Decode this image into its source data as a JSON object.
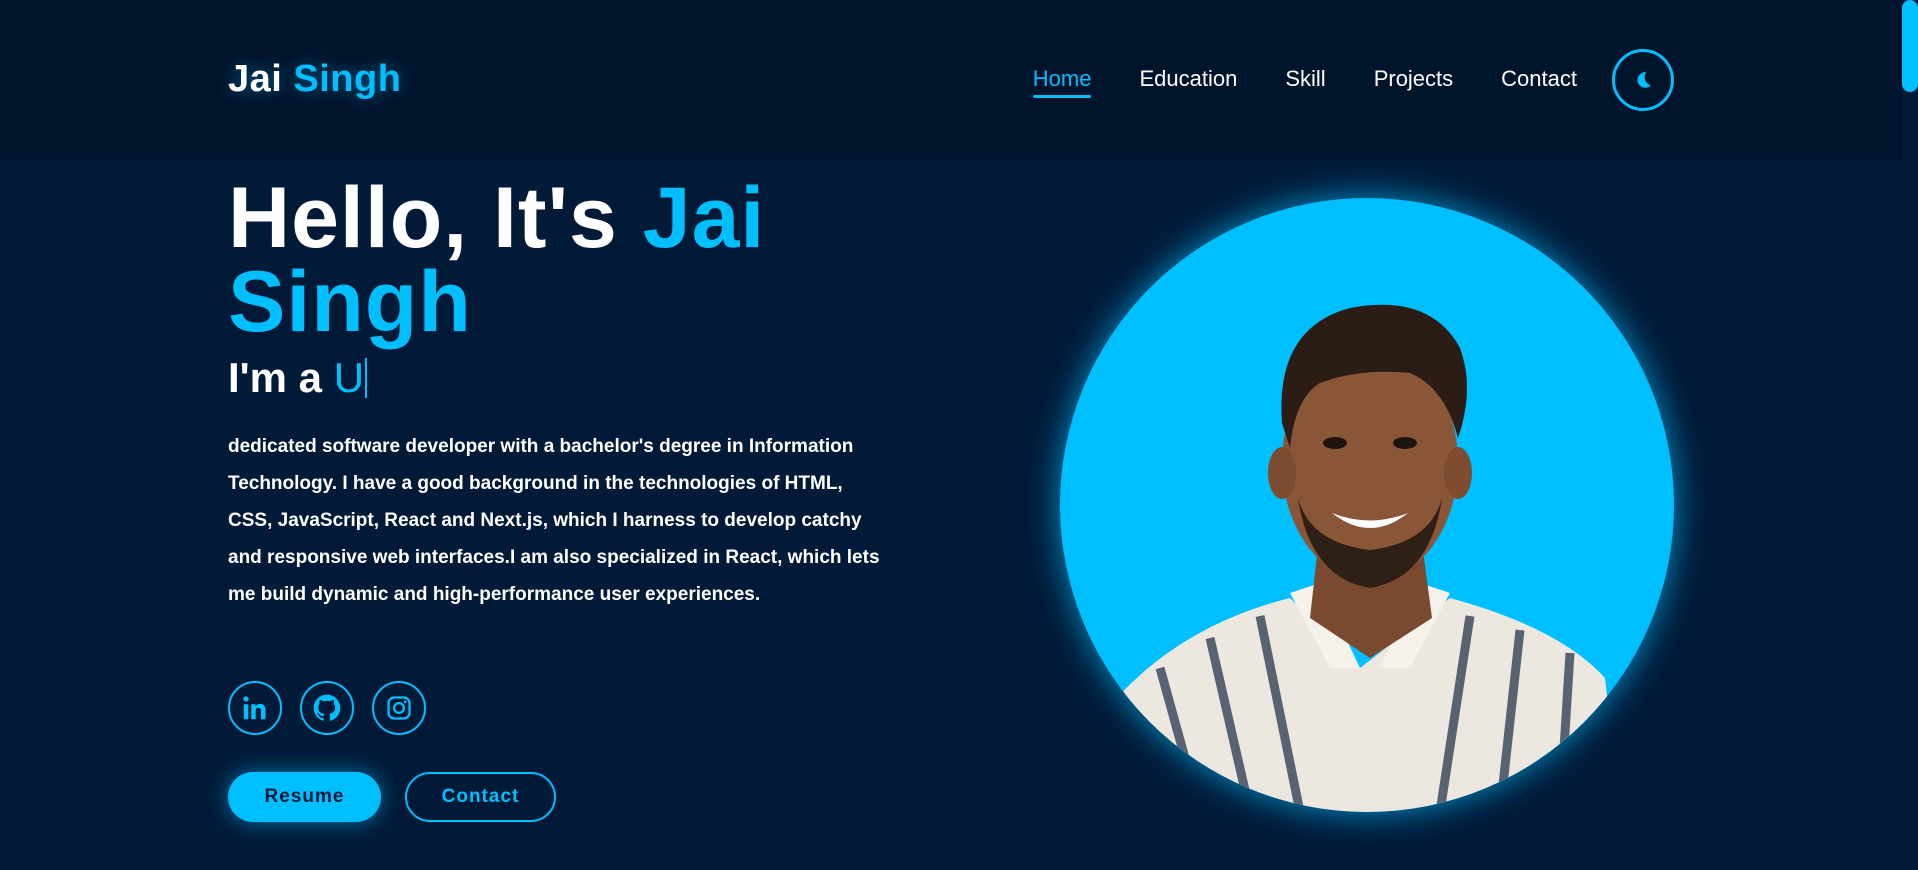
{
  "logo": {
    "first": "Jai",
    "last": "Singh"
  },
  "nav": [
    {
      "label": "Home",
      "active": true
    },
    {
      "label": "Education"
    },
    {
      "label": "Skill"
    },
    {
      "label": "Projects"
    },
    {
      "label": "Contact"
    }
  ],
  "theme_toggle": {
    "icon": "moon-icon"
  },
  "hero": {
    "greeting": "Hello, It's",
    "name_first": "Jai",
    "name_last": "Singh",
    "typing_prefix": "I'm a",
    "typing_text": "U",
    "bio": "dedicated software developer with a bachelor's degree in Information Technology. I have a good background in the technologies of HTML, CSS, JavaScript, React and Next.js, which I harness to develop catchy and responsive web interfaces.I am also specialized in React, which lets me build dynamic and high-performance user experiences."
  },
  "socials": [
    {
      "icon": "linkedin-icon"
    },
    {
      "icon": "github-icon"
    },
    {
      "icon": "instagram-icon"
    }
  ],
  "buttons": {
    "resume": "Resume",
    "contact": "Contact"
  },
  "colors": {
    "accent": "#00bfff",
    "background": "#011a38",
    "header": "#00142b"
  }
}
